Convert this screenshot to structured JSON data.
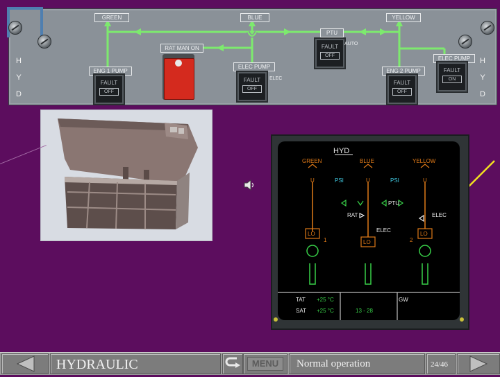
{
  "overhead_panel": {
    "side_letters": [
      "H",
      "Y",
      "D"
    ],
    "systems": {
      "green": "GREEN",
      "blue": "BLUE",
      "yellow": "YELLOW"
    },
    "ptu_label": "PTU",
    "rat_label": "RAT MAN ON",
    "auto_label": "AUTO",
    "buttons": {
      "eng1_pump": {
        "title": "ENG 1 PUMP",
        "fault": "FAULT",
        "state": "OFF"
      },
      "blue_elec_pump": {
        "title": "ELEC PUMP",
        "fault": "FAULT",
        "state": "OFF",
        "vertical": "ELEC"
      },
      "ptu": {
        "fault": "FAULT",
        "state": "OFF"
      },
      "eng2_pump": {
        "title": "ENG 2 PUMP",
        "fault": "FAULT",
        "state": "OFF"
      },
      "yellow_elec_pump": {
        "title": "ELEC PUMP",
        "fault": "FAULT",
        "state": "ON"
      }
    },
    "line_color": "#7dea6e"
  },
  "ecam": {
    "title": "HYD",
    "systems": [
      "GREEN",
      "BLUE",
      "YELLOW"
    ],
    "pump_marks": [
      "U",
      "U",
      "U"
    ],
    "psi_labels": [
      "PSI",
      "PSI"
    ],
    "ptu_label": "PTU",
    "rat_label": "RAT",
    "elec_label_blue": "ELEC",
    "elec_label_yellow": "ELEC",
    "pump_boxes": [
      "LO",
      "LO",
      "LO"
    ],
    "engine_numbers": [
      "1",
      "2"
    ],
    "bottom": {
      "tat_label": "TAT",
      "tat_value": "+25 °C",
      "sat_label": "SAT",
      "sat_value": "+25 °C",
      "time": "13 - 28",
      "gw_label": "GW"
    },
    "colors": {
      "amber": "#e07a18",
      "green": "#38d048",
      "white": "#e8e8e8",
      "cyan": "#40c8e0"
    }
  },
  "navigation": {
    "prev_icon": "left-arrow-icon",
    "section": "HYDRAULIC",
    "return_icon": "return-arrow-icon",
    "menu_label": "MENU",
    "subtitle": "Normal operation",
    "page": "24/46",
    "next_icon": "right-arrow-icon"
  }
}
